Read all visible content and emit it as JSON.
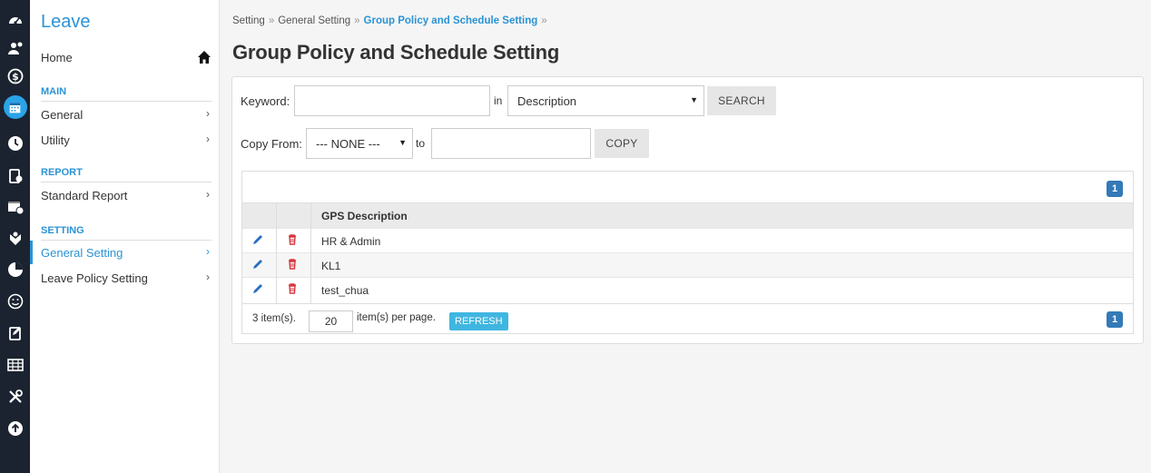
{
  "app": {
    "title": "Leave"
  },
  "sidebar": {
    "home": "Home",
    "sections": [
      {
        "title": "MAIN",
        "items": [
          {
            "label": "General"
          },
          {
            "label": "Utility"
          }
        ]
      },
      {
        "title": "REPORT",
        "items": [
          {
            "label": "Standard Report"
          }
        ]
      },
      {
        "title": "SETTING",
        "items": [
          {
            "label": "General Setting",
            "active": true
          },
          {
            "label": "Leave Policy Setting"
          }
        ]
      }
    ],
    "chevron": "›"
  },
  "iconbar": [
    "dashboard-icon",
    "user-settings-icon",
    "dollar-icon",
    "calendar-icon",
    "clock-icon",
    "document-icon",
    "calendar-clock-icon",
    "gift-icon",
    "chart-icon",
    "smile-icon",
    "clipboard-icon",
    "table-icon",
    "tools-icon",
    "upload-icon"
  ],
  "breadcrumb": {
    "items": [
      "Setting",
      "General Setting",
      "Group Policy and Schedule Setting"
    ],
    "sep": "»"
  },
  "page": {
    "title": "Group Policy and Schedule Setting"
  },
  "search": {
    "keyword_label": "Keyword:",
    "keyword_value": "",
    "in_label": "in",
    "field_value": "Description",
    "search_button": "SEARCH"
  },
  "copy": {
    "from_label": "Copy From:",
    "from_value": "--- NONE ---",
    "to_label": "to",
    "to_value": "",
    "copy_button": "COPY"
  },
  "grid": {
    "page_badge": "1",
    "column_header": "GPS Description",
    "rows": [
      "HR & Admin",
      "KL1",
      "test_chua"
    ],
    "footer": {
      "count_text": "3 item(s).",
      "per_page_value": "20",
      "per_page_label": "item(s) per page.",
      "refresh_button": "REFRESH",
      "page_badge": "1"
    }
  },
  "colors": {
    "accent": "#2a93d5",
    "iconbar": "#1b2330",
    "badge": "#337ab7",
    "refresh": "#3fb6e0",
    "delete": "#d9363e"
  }
}
